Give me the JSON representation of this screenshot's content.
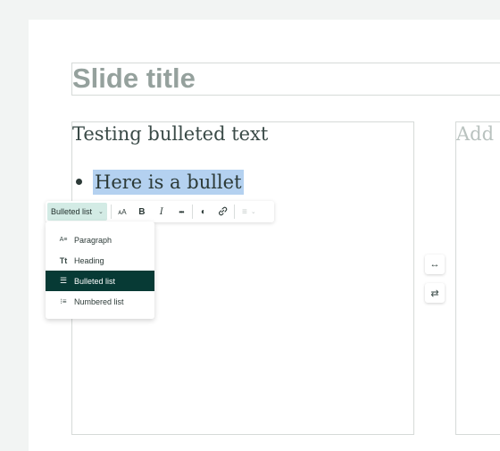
{
  "slide": {
    "title": "Slide title",
    "body_heading": "Testing bulleted text",
    "bullet": "Here is a bullet",
    "right_placeholder": "Add t"
  },
  "toolbar": {
    "style_select_label": "Bulleted list",
    "buttons": [
      {
        "name": "text-size-icon",
        "glyph": "ᴀA"
      },
      {
        "name": "bold-icon",
        "glyph": "B"
      },
      {
        "name": "italic-icon",
        "glyph": "I"
      },
      {
        "name": "more-icon",
        "glyph": "•••"
      },
      {
        "name": "highlight-icon",
        "glyph": "◐"
      },
      {
        "name": "link-icon",
        "glyph": "🔗"
      },
      {
        "name": "align-icon",
        "glyph": "≡"
      }
    ]
  },
  "dropdown": {
    "items": [
      {
        "label": "Paragraph",
        "icon": "paragraph-icon",
        "glyph": "A≡",
        "selected": false
      },
      {
        "label": "Heading",
        "icon": "heading-icon",
        "glyph": "Tt",
        "selected": false
      },
      {
        "label": "Bulleted list",
        "icon": "bulleted-list-icon",
        "glyph": "☰",
        "selected": true
      },
      {
        "label": "Numbered list",
        "icon": "numbered-list-icon",
        "glyph": "⁝≡",
        "selected": false
      }
    ]
  },
  "side_buttons": [
    {
      "name": "resize-horizontal-icon",
      "glyph": "↔"
    },
    {
      "name": "swap-icon",
      "glyph": "⇄"
    }
  ],
  "colors": {
    "accent_dark": "#073a35",
    "select_bg": "#d3ebe5",
    "selection_highlight": "#b4d1f0"
  }
}
